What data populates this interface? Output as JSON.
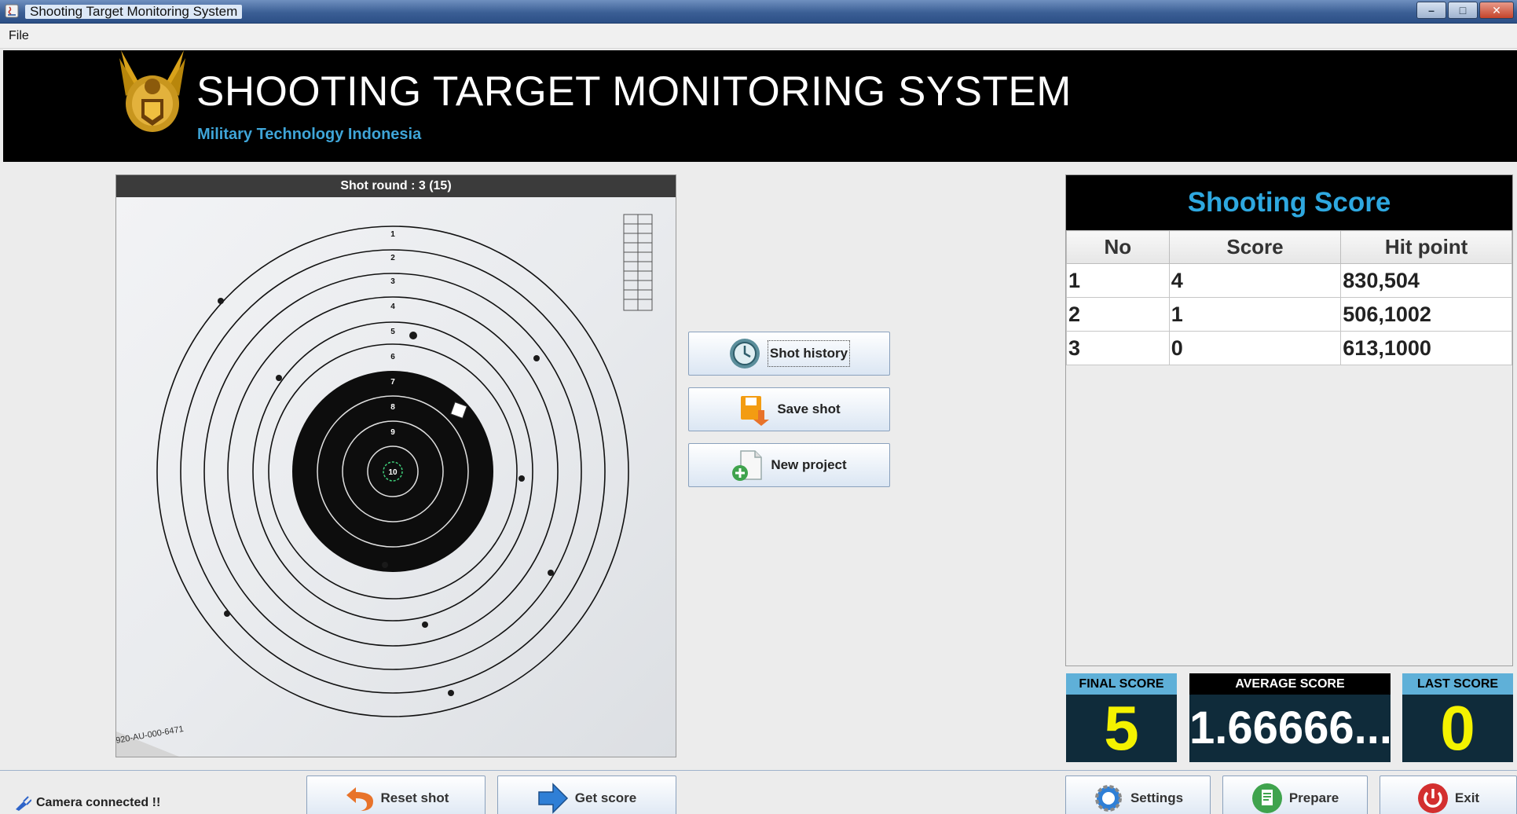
{
  "window": {
    "title": "Shooting Target Monitoring System",
    "controls": [
      "minimize",
      "maximize",
      "close"
    ]
  },
  "menu": {
    "items": [
      "File"
    ]
  },
  "header": {
    "title": "SHOOTING TARGET MONITORING SYSTEM",
    "subtitle": "Military Technology Indonesia"
  },
  "target": {
    "header": "Shot round : 3 (15)",
    "serial": "920-AU-000-6471",
    "ring_numbers": [
      "1",
      "2",
      "3",
      "4",
      "5",
      "6",
      "7",
      "8",
      "9",
      "10"
    ]
  },
  "actions": {
    "shot_history": "Shot history",
    "save_shot": "Save shot",
    "new_project": "New project"
  },
  "scoreboard": {
    "title": "Shooting Score",
    "columns": [
      "No",
      "Score",
      "Hit point"
    ],
    "rows": [
      [
        "1",
        "4",
        "830,504"
      ],
      [
        "2",
        "1",
        "506,1002"
      ],
      [
        "3",
        "0",
        "613,1000"
      ]
    ]
  },
  "summary": {
    "final_label": "FINAL SCORE",
    "final_value": "5",
    "average_label": "AVERAGE SCORE",
    "average_value": "1.66666...",
    "last_label": "LAST SCORE",
    "last_value": "0"
  },
  "status": {
    "text": "Camera connected !!"
  },
  "footer_buttons": {
    "reset": "Reset shot",
    "get_score": "Get score",
    "settings": "Settings",
    "prepare": "Prepare",
    "exit": "Exit"
  },
  "colors": {
    "accent_blue": "#2ea8e0",
    "score_yellow": "#f4f200",
    "box_bg": "#0f2b3a"
  }
}
